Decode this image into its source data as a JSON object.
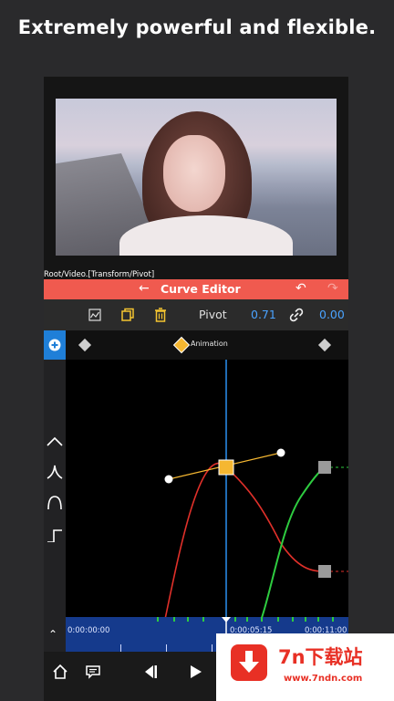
{
  "headline": "Extremely powerful and flexible.",
  "preview": {
    "path": "Root/Video.[Transform/Pivot]"
  },
  "curve_editor": {
    "title": "Curve Editor",
    "back_icon": "back-arrow-icon",
    "undo_icon": "undo-icon",
    "redo_icon": "redo-icon"
  },
  "toolbar": {
    "pivot_label": "Pivot",
    "pivot_value": "0.71",
    "link_value": "0.00",
    "icons": [
      "graph-icon",
      "copy-icon",
      "trash-icon",
      "link-icon"
    ]
  },
  "keyframe_row": {
    "label": "Animation"
  },
  "left_tools": [
    "ease-peak-icon",
    "ease-sharp-icon",
    "ease-round-icon",
    "step-icon"
  ],
  "timeline": {
    "start": "0:00:00:00",
    "current": "0:00:05:15",
    "end": "0:00:11:00"
  },
  "bottom_bar": {
    "icons": [
      "home-icon",
      "comment-icon",
      "skip-back-icon",
      "play-icon"
    ]
  },
  "watermark": {
    "title": "7n下载站",
    "url": "www.7ndn.com"
  },
  "colors": {
    "accent_red": "#f05a4f",
    "accent_blue": "#1f7fd8",
    "value_blue": "#4aa3ff",
    "curve_red": "#e0302a",
    "curve_green": "#2ecc40",
    "keyframe_yellow": "#f5b731"
  }
}
